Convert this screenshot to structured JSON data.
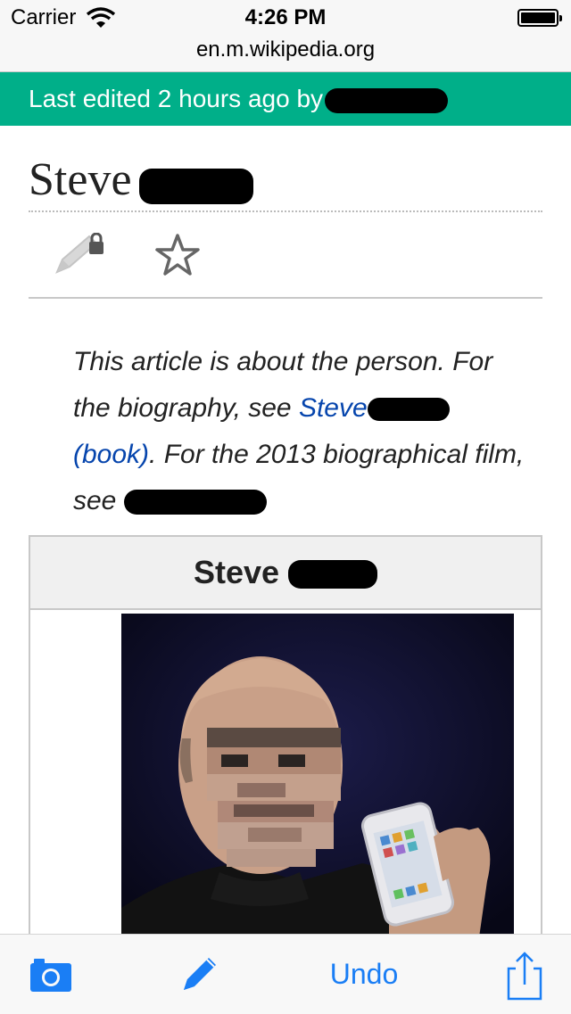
{
  "status_bar": {
    "carrier": "Carrier",
    "time": "4:26 PM",
    "url": "en.m.wikipedia.org"
  },
  "banner": {
    "text": "Last edited 2 hours ago by",
    "color": "#00af89"
  },
  "article": {
    "title": "Steve",
    "actions": [
      {
        "icon": "pencil-lock-icon"
      },
      {
        "icon": "star-icon"
      }
    ],
    "hatnote": {
      "part1": "This article is about the person. For the biography, see ",
      "link1": "Steve",
      "link2": "(book)",
      "part2": ". For the 2013 biographical film, see "
    },
    "infobox": {
      "title": "Steve"
    }
  },
  "toolbar": {
    "undo_label": "Undo",
    "accent": "#1a7ef5",
    "icons": [
      "camera-icon",
      "pencil-icon",
      "share-icon"
    ]
  }
}
